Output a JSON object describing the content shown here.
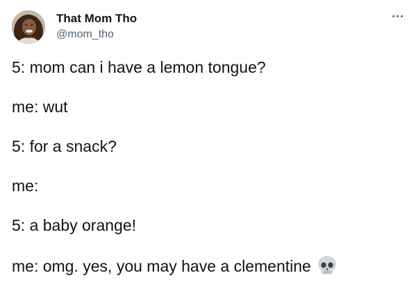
{
  "tweet": {
    "author_name": "That Mom Tho",
    "author_handle": "@mom_tho",
    "more_icon": "more-horizontal-icon",
    "avatar_icon": "avatar-photo",
    "lines": [
      "5: mom can i have a lemon tongue?",
      "me: wut",
      "5: for a snack?",
      "me:",
      "5: a baby orange!",
      "me: omg. yes, you may have a clementine"
    ],
    "emoji": "skull-emoji-icon"
  },
  "colors": {
    "text": "#0f1419",
    "secondary": "#536471",
    "background": "#ffffff"
  }
}
